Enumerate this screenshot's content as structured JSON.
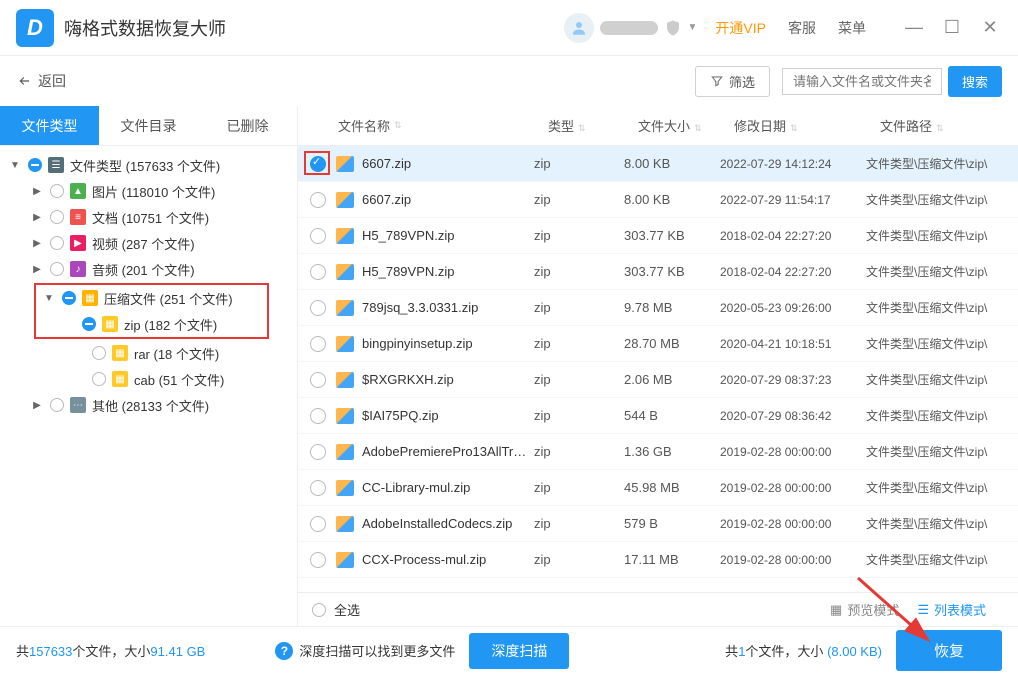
{
  "titlebar": {
    "app_name": "嗨格式数据恢复大师",
    "vip": "开通VIP",
    "support": "客服",
    "menu": "菜单"
  },
  "toolbar": {
    "back": "返回",
    "filter": "筛选",
    "search_placeholder": "请输入文件名或文件夹名",
    "search": "搜索"
  },
  "sidebar": {
    "tabs": [
      "文件类型",
      "文件目录",
      "已删除"
    ],
    "active_tab": 0,
    "tree": {
      "root": "文件类型 (157633 个文件)",
      "images": "图片 (118010 个文件)",
      "docs": "文档 (10751 个文件)",
      "video": "视频 (287 个文件)",
      "audio": "音频 (201 个文件)",
      "archive": "压缩文件 (251 个文件)",
      "zip": "zip (182 个文件)",
      "rar": "rar (18 个文件)",
      "cab": "cab (51 个文件)",
      "other": "其他 (28133 个文件)"
    }
  },
  "table": {
    "headers": {
      "name": "文件名称",
      "type": "类型",
      "size": "文件大小",
      "date": "修改日期",
      "path": "文件路径"
    },
    "rows": [
      {
        "checked": true,
        "name": "6607.zip",
        "type": "zip",
        "size": "8.00 KB",
        "date": "2022-07-29 14:12:24",
        "path": "文件类型\\压缩文件\\zip\\"
      },
      {
        "checked": false,
        "name": "6607.zip",
        "type": "zip",
        "size": "8.00 KB",
        "date": "2022-07-29 11:54:17",
        "path": "文件类型\\压缩文件\\zip\\"
      },
      {
        "checked": false,
        "name": "H5_789VPN.zip",
        "type": "zip",
        "size": "303.77 KB",
        "date": "2018-02-04 22:27:20",
        "path": "文件类型\\压缩文件\\zip\\"
      },
      {
        "checked": false,
        "name": "H5_789VPN.zip",
        "type": "zip",
        "size": "303.77 KB",
        "date": "2018-02-04 22:27:20",
        "path": "文件类型\\压缩文件\\zip\\"
      },
      {
        "checked": false,
        "name": "789jsq_3.3.0331.zip",
        "type": "zip",
        "size": "9.78 MB",
        "date": "2020-05-23 09:26:00",
        "path": "文件类型\\压缩文件\\zip\\"
      },
      {
        "checked": false,
        "name": "bingpinyinsetup.zip",
        "type": "zip",
        "size": "28.70 MB",
        "date": "2020-04-21 10:18:51",
        "path": "文件类型\\压缩文件\\zip\\"
      },
      {
        "checked": false,
        "name": "$RXGRKXH.zip",
        "type": "zip",
        "size": "2.06 MB",
        "date": "2020-07-29 08:37:23",
        "path": "文件类型\\压缩文件\\zip\\"
      },
      {
        "checked": false,
        "name": "$IAI75PQ.zip",
        "type": "zip",
        "size": "544 B",
        "date": "2020-07-29 08:36:42",
        "path": "文件类型\\压缩文件\\zip\\"
      },
      {
        "checked": false,
        "name": "AdobePremierePro13AllTr…",
        "type": "zip",
        "size": "1.36 GB",
        "date": "2019-02-28 00:00:00",
        "path": "文件类型\\压缩文件\\zip\\"
      },
      {
        "checked": false,
        "name": "CC-Library-mul.zip",
        "type": "zip",
        "size": "45.98 MB",
        "date": "2019-02-28 00:00:00",
        "path": "文件类型\\压缩文件\\zip\\"
      },
      {
        "checked": false,
        "name": "AdobeInstalledCodecs.zip",
        "type": "zip",
        "size": "579 B",
        "date": "2019-02-28 00:00:00",
        "path": "文件类型\\压缩文件\\zip\\"
      },
      {
        "checked": false,
        "name": "CCX-Process-mul.zip",
        "type": "zip",
        "size": "17.11 MB",
        "date": "2019-02-28 00:00:00",
        "path": "文件类型\\压缩文件\\zip\\"
      }
    ]
  },
  "table_footer": {
    "select_all": "全选",
    "preview_mode": "预览模式",
    "list_mode": "列表模式"
  },
  "bottom": {
    "total_prefix": "共",
    "total_count": "157633",
    "total_mid": "个文件，大小",
    "total_size": "91.41 GB",
    "deep_tip": "深度扫描可以找到更多文件",
    "deep_btn": "深度扫描",
    "sel_prefix": "共",
    "sel_count": "1",
    "sel_mid": "个文件，大小",
    "sel_size": "(8.00 KB)",
    "recover": "恢复"
  }
}
